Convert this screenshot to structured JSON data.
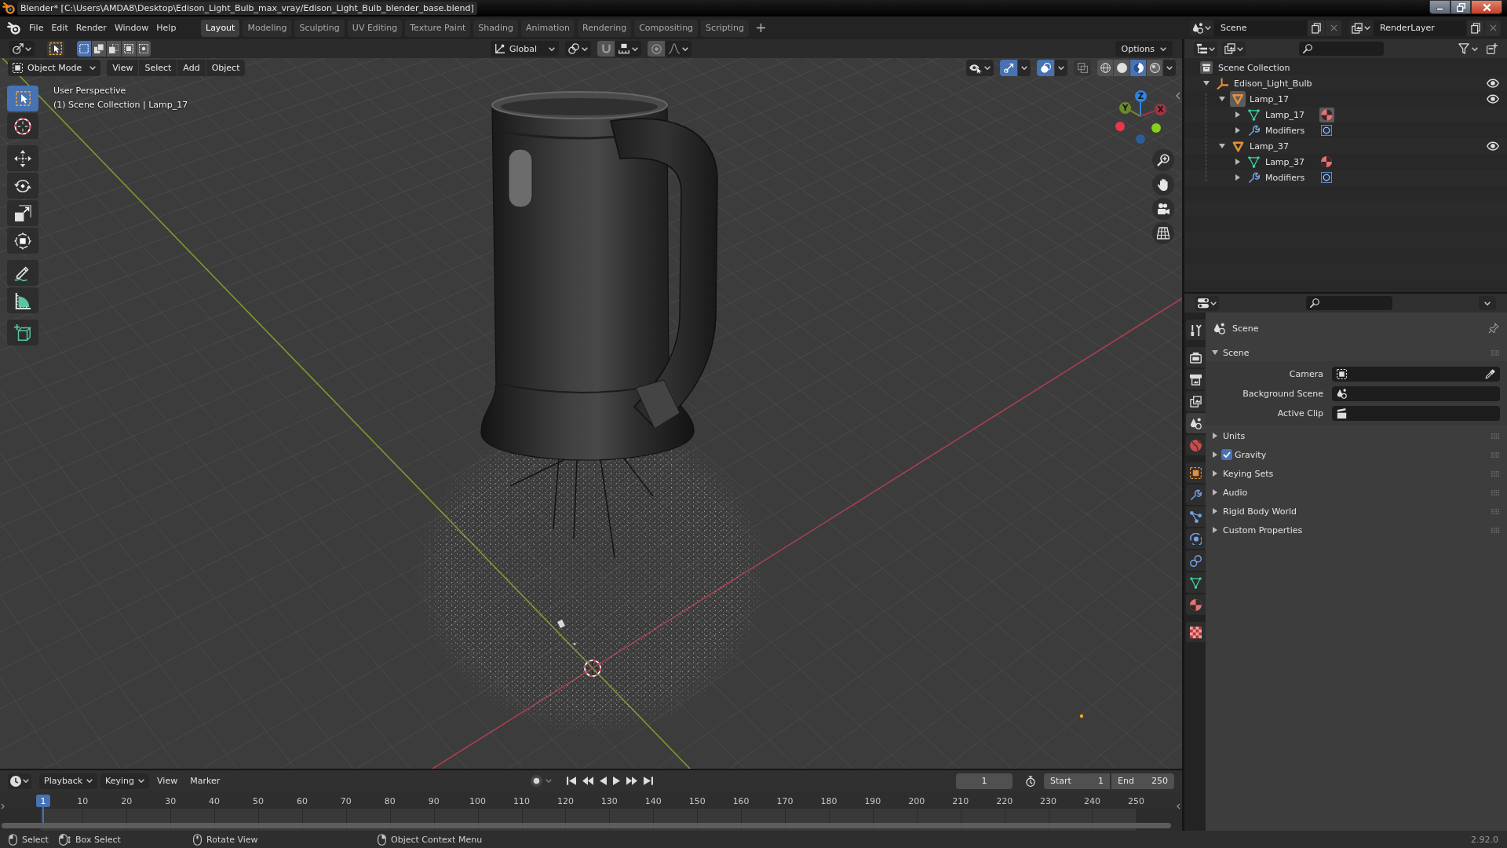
{
  "window": {
    "title": "Blender* [C:\\Users\\AMDA8\\Desktop\\Edison_Light_Bulb_max_vray/Edison_Light_Bulb_blender_base.blend]"
  },
  "menu_bar": [
    "File",
    "Edit",
    "Render",
    "Window",
    "Help"
  ],
  "workspace_tabs": [
    {
      "label": "Layout",
      "selected": true
    },
    {
      "label": "Modeling",
      "selected": false
    },
    {
      "label": "Sculpting",
      "selected": false
    },
    {
      "label": "UV Editing",
      "selected": false
    },
    {
      "label": "Texture Paint",
      "selected": false
    },
    {
      "label": "Shading",
      "selected": false
    },
    {
      "label": "Animation",
      "selected": false
    },
    {
      "label": "Rendering",
      "selected": false
    },
    {
      "label": "Compositing",
      "selected": false
    },
    {
      "label": "Scripting",
      "selected": false
    }
  ],
  "scene_selector": {
    "value": "Scene"
  },
  "view_layer_selector": {
    "value": "RenderLayer"
  },
  "tool_header": {
    "selection_modes": [
      {
        "kind": "set",
        "selected": true
      },
      {
        "kind": "extend",
        "selected": false
      },
      {
        "kind": "subtract",
        "selected": false
      },
      {
        "kind": "difference",
        "selected": false
      },
      {
        "kind": "intersect",
        "selected": false
      }
    ],
    "orientation": "Global",
    "options": "Options"
  },
  "viewport_header": {
    "mode": "Object Mode",
    "menus": [
      "View",
      "Select",
      "Add",
      "Object"
    ],
    "gizmos": {
      "on": true
    },
    "overlays": {
      "on": true
    },
    "xray": {
      "on": false
    },
    "shading": [
      {
        "kind": "wireframe",
        "selected": false
      },
      {
        "kind": "solid",
        "selected": false
      },
      {
        "kind": "material",
        "selected": true
      },
      {
        "kind": "rendered",
        "selected": false
      }
    ]
  },
  "toolbar": [
    {
      "kind": "select_box",
      "selected": true
    },
    {
      "kind": "cursor",
      "selected": false
    },
    {
      "kind": "move",
      "selected": false
    },
    {
      "kind": "rotate",
      "selected": false
    },
    {
      "kind": "scale",
      "selected": false
    },
    {
      "kind": "transform",
      "selected": false
    },
    {
      "kind": "annotate",
      "selected": false
    },
    {
      "kind": "measure",
      "selected": false
    },
    {
      "kind": "add_cube",
      "selected": false
    }
  ],
  "viewport": {
    "view_name": "User Perspective",
    "context": "(1) Scene Collection | Lamp_17"
  },
  "navigation_gizmo": {
    "axes": [
      {
        "label": "Z",
        "color": "#2f84df"
      },
      {
        "label": "Y",
        "color": "#6b8b2b"
      },
      {
        "label": "X",
        "color": "#a03443"
      }
    ],
    "negative_axes": [
      {
        "color": "#e8374f"
      },
      {
        "color": "#86cf1b"
      },
      {
        "color": "#2c5d98"
      }
    ]
  },
  "outliner": {
    "root": "Scene Collection",
    "items": [
      {
        "label": "Edison_Light_Bulb",
        "kind": "empty",
        "expanded": true,
        "active": false,
        "visible": true,
        "children": [
          {
            "label": "Lamp_17",
            "kind": "object",
            "expanded": true,
            "active": true,
            "visible": true,
            "children": [
              {
                "label": "Lamp_17",
                "kind": "mesh",
                "expanded": false,
                "active": true
              },
              {
                "label": "Modifiers",
                "kind": "modifiers",
                "expanded": false,
                "active": false
              }
            ]
          },
          {
            "label": "Lamp_37",
            "kind": "object",
            "expanded": true,
            "active": false,
            "visible": true,
            "children": [
              {
                "label": "Lamp_37",
                "kind": "mesh",
                "expanded": false,
                "active": false
              },
              {
                "label": "Modifiers",
                "kind": "modifiers",
                "expanded": false,
                "active": false
              }
            ]
          }
        ]
      }
    ]
  },
  "properties": {
    "tabs": [
      {
        "kind": "tool",
        "selected": false
      },
      {
        "kind": "render",
        "selected": false
      },
      {
        "kind": "output",
        "selected": false
      },
      {
        "kind": "view_layer",
        "selected": false
      },
      {
        "kind": "scene",
        "selected": true
      },
      {
        "kind": "world",
        "selected": false
      },
      {
        "kind": "object",
        "selected": false
      },
      {
        "kind": "modifiers",
        "selected": false
      },
      {
        "kind": "particles",
        "selected": false
      },
      {
        "kind": "physics",
        "selected": false
      },
      {
        "kind": "constraints",
        "selected": false
      },
      {
        "kind": "data",
        "selected": false
      },
      {
        "kind": "material",
        "selected": false
      },
      {
        "kind": "texture",
        "selected": false
      }
    ],
    "context": "Scene",
    "panels": [
      {
        "title": "Scene",
        "expanded": true,
        "fields": [
          {
            "label": "Camera",
            "kind": "camera"
          },
          {
            "label": "Background Scene",
            "kind": "scene"
          },
          {
            "label": "Active Clip",
            "kind": "clip"
          }
        ]
      },
      {
        "title": "Units",
        "expanded": false
      },
      {
        "title": "Gravity",
        "expanded": false,
        "toggle": {
          "checked": true
        }
      },
      {
        "title": "Keying Sets",
        "expanded": false
      },
      {
        "title": "Audio",
        "expanded": false
      },
      {
        "title": "Rigid Body World",
        "expanded": false
      },
      {
        "title": "Custom Properties",
        "expanded": false
      }
    ]
  },
  "timeline": {
    "menus": [
      {
        "label": "Playback",
        "kind": "dropdown"
      },
      {
        "label": "Keying",
        "kind": "dropdown"
      },
      {
        "label": "View",
        "kind": "menu"
      },
      {
        "label": "Marker",
        "kind": "menu"
      }
    ],
    "auto_keying": {
      "on": false
    },
    "current_frame": "1",
    "frame_start": {
      "label": "Start",
      "value": "1"
    },
    "frame_end": {
      "label": "End",
      "value": "250"
    },
    "ruler": [
      "10",
      "20",
      "30",
      "40",
      "50",
      "60",
      "70",
      "80",
      "90",
      "100",
      "110",
      "120",
      "130",
      "140",
      "150",
      "160",
      "170",
      "180",
      "190",
      "200",
      "210",
      "220",
      "230",
      "240",
      "250"
    ],
    "playhead": "1"
  },
  "status_bar": {
    "hints": [
      {
        "kind": "mouse_left",
        "label": "Select"
      },
      {
        "kind": "mouse_drag",
        "label": "Box Select"
      },
      {
        "kind": "mouse_middle",
        "label": "Rotate View"
      },
      {
        "kind": "mouse_right",
        "label": "Object Context Menu"
      }
    ],
    "version": "2.92.0"
  }
}
